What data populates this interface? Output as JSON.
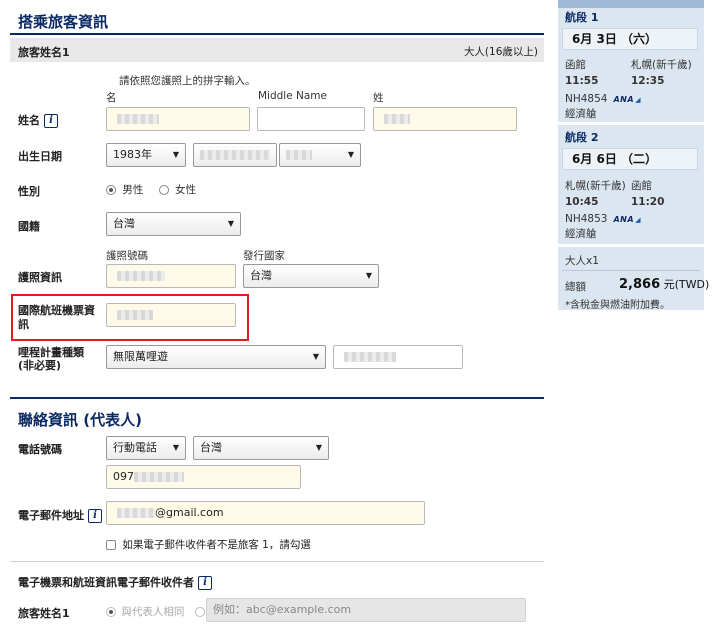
{
  "passenger_section": {
    "title": "搭乘旅客資訊",
    "passenger_label": "旅客姓名1",
    "passenger_type": "大人(16歲以上)",
    "name_hint": "請依照您護照上的拼字輸入。",
    "name_label": "姓名",
    "first_name_col": "名",
    "middle_name_col": "Middle Name",
    "last_name_col": "姓",
    "dob_label": "出生日期",
    "dob_year": "1983年",
    "gender_label": "性別",
    "gender_male": "男性",
    "gender_female": "女性",
    "nationality_label": "國籍",
    "nationality_value": "台灣",
    "passport_label": "護照資訊",
    "passport_number_col": "護照號碼",
    "issuing_country_col": "發行國家",
    "issuing_country_value": "台灣",
    "intl_ticket_label": "國際航班機票資訊",
    "mileage_label": "哩程計畫種類 (非必要)",
    "mileage_program_value": "無限萬哩遊"
  },
  "contact_section": {
    "title": "聯絡資訊 (代表人)",
    "phone_label": "電話號碼",
    "phone_type_value": "行動電話",
    "phone_country_value": "台灣",
    "phone_number_prefix": "097",
    "email_label": "電子郵件地址",
    "email_suffix": "@gmail.com",
    "email_not_passenger_text": "如果電子郵件收件者不是旅客 1，請勾選",
    "eticket_recipient_title": "電子機票和航班資訊電子郵件收件者",
    "recipient_passenger_label": "旅客姓名1",
    "same_as_representative": "與代表人相同",
    "email_example_placeholder": "例如：abc@example.com"
  },
  "sidebar": {
    "segment1": {
      "label": "航段 1",
      "date": "6月 3日 （六）",
      "from_city": "函館",
      "to_city": "札幌(新千歲)",
      "depart_time": "11:55",
      "arrive_time": "12:35",
      "flight_number": "NH4854",
      "airline_logo": "ANA",
      "cabin": "經濟艙"
    },
    "segment2": {
      "label": "航段 2",
      "date": "6月 6日 （二）",
      "from_city": "札幌(新千歲)",
      "to_city": "函館",
      "depart_time": "10:45",
      "arrive_time": "11:20",
      "flight_number": "NH4853",
      "airline_logo": "ANA",
      "cabin": "經濟艙"
    },
    "passenger_count": "大人x1",
    "total_label": "總額",
    "total_amount": "2,866",
    "currency": "元(TWD)",
    "tax_note": "*含稅金與燃油附加費。"
  },
  "colors": {
    "heading_navy": "#0b2a63",
    "field_bg": "#fffbe8",
    "highlight_red": "#e01b1b",
    "sidebar_bg": "#dce6f1",
    "sidebar_header": "#9fb9d6"
  }
}
